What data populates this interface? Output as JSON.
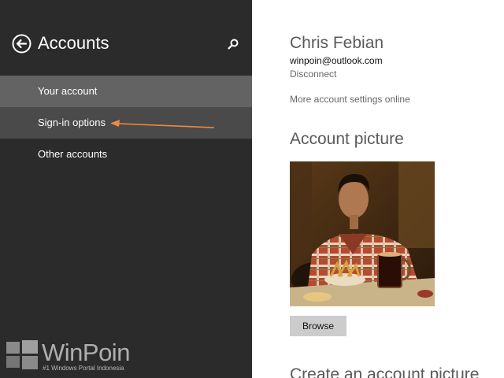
{
  "sidebar": {
    "title": "Accounts",
    "back_icon": "back-arrow-icon",
    "search_icon": "search-icon",
    "items": [
      {
        "label": "Your account",
        "state": "selected"
      },
      {
        "label": "Sign-in options",
        "state": "hover"
      },
      {
        "label": "Other accounts",
        "state": "normal"
      }
    ],
    "annotation_color": "#f08a3c"
  },
  "watermark": {
    "name": "WinPoin",
    "tagline": "#1 Windows Portal Indonesia"
  },
  "account": {
    "name": "Chris Febian",
    "email": "winpoin@outlook.com",
    "disconnect_label": "Disconnect",
    "more_settings_label": "More account settings online"
  },
  "picture": {
    "section_title": "Account picture",
    "browse_label": "Browse",
    "create_title": "Create an account picture"
  },
  "colors": {
    "sidebar_bg": "#2b2b2b",
    "selected_bg": "#636363",
    "hover_bg": "#4a4a4a",
    "content_bg": "#ffffff",
    "button_bg": "#cccccc"
  }
}
